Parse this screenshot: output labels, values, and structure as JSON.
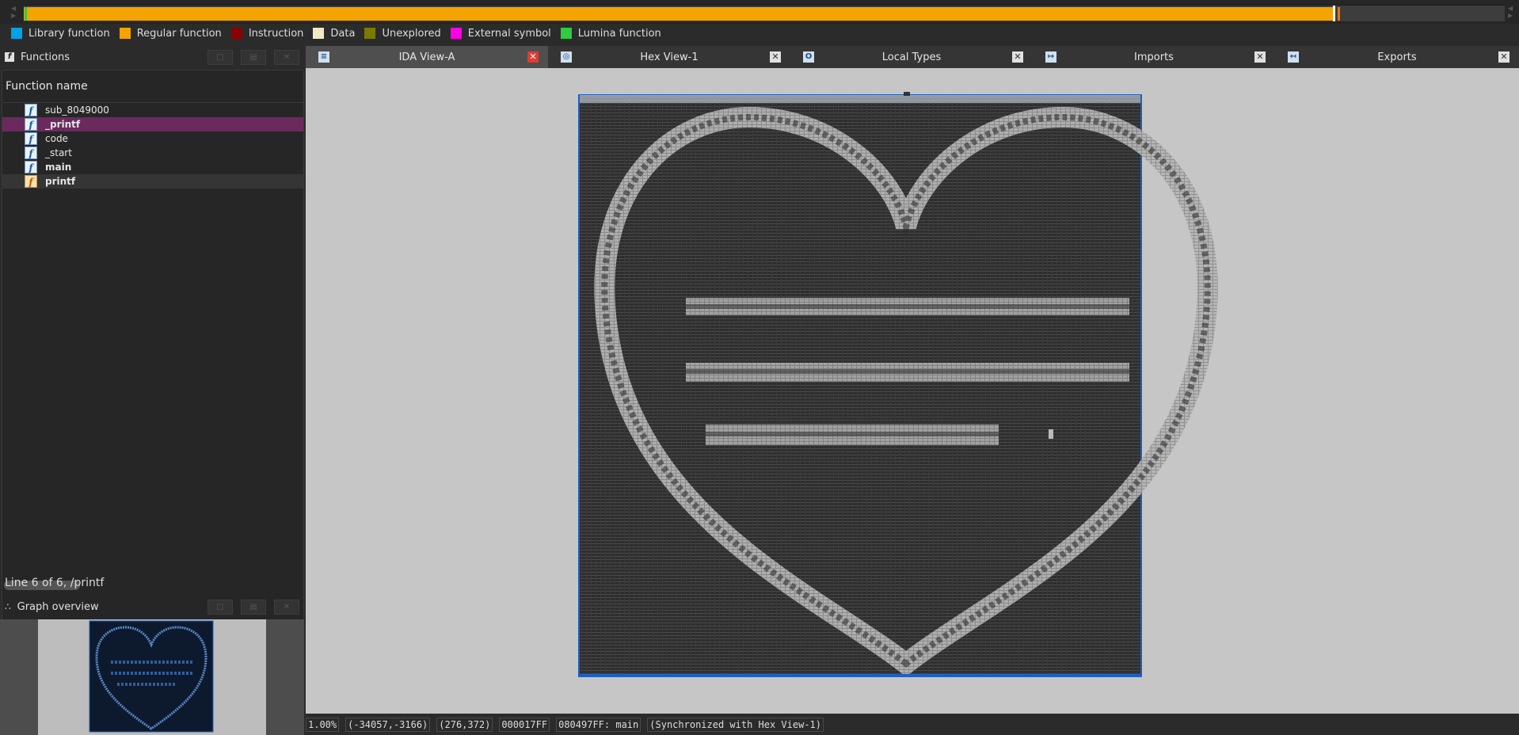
{
  "legend": [
    {
      "label": "Library function",
      "color": "#00a2e8"
    },
    {
      "label": "Regular function",
      "color": "#f5a300"
    },
    {
      "label": "Instruction",
      "color": "#8b0000"
    },
    {
      "label": "Data",
      "color": "#f2e8c4"
    },
    {
      "label": "Unexplored",
      "color": "#7a7a00"
    },
    {
      "label": "External symbol",
      "color": "#ff00e6"
    },
    {
      "label": "Lumina function",
      "color": "#2ecc40"
    }
  ],
  "functions_panel": {
    "title": "Functions",
    "icon": "function-icon",
    "column_header": "Function name",
    "rows": [
      {
        "name": "sub_8049000",
        "bold": false,
        "kind": "regular"
      },
      {
        "name": "_printf",
        "bold": true,
        "kind": "regular",
        "selected": true
      },
      {
        "name": "code",
        "bold": false,
        "kind": "regular"
      },
      {
        "name": "_start",
        "bold": false,
        "kind": "regular"
      },
      {
        "name": "main",
        "bold": true,
        "kind": "regular"
      },
      {
        "name": "printf",
        "bold": true,
        "kind": "external",
        "highlighted": true
      }
    ],
    "status": "Line 6 of 6, /printf"
  },
  "graph_overview": {
    "title": "Graph overview",
    "icon": "graph-overview-icon"
  },
  "tabs": [
    {
      "label": "IDA View-A",
      "icon": "ida-view-icon",
      "active": true
    },
    {
      "label": "Hex View-1",
      "icon": "hex-view-icon",
      "active": false
    },
    {
      "label": "Local Types",
      "icon": "local-types-icon",
      "active": false
    },
    {
      "label": "Imports",
      "icon": "imports-icon",
      "active": false
    },
    {
      "label": "Exports",
      "icon": "exports-icon",
      "active": false
    }
  ],
  "status_bar": {
    "zoom": "1.00%",
    "coords": "(-34057,-3166)",
    "size": "(276,372)",
    "offset": "000017FF",
    "address": "080497FF: main",
    "sync": "(Synchronized with Hex View-1)"
  }
}
